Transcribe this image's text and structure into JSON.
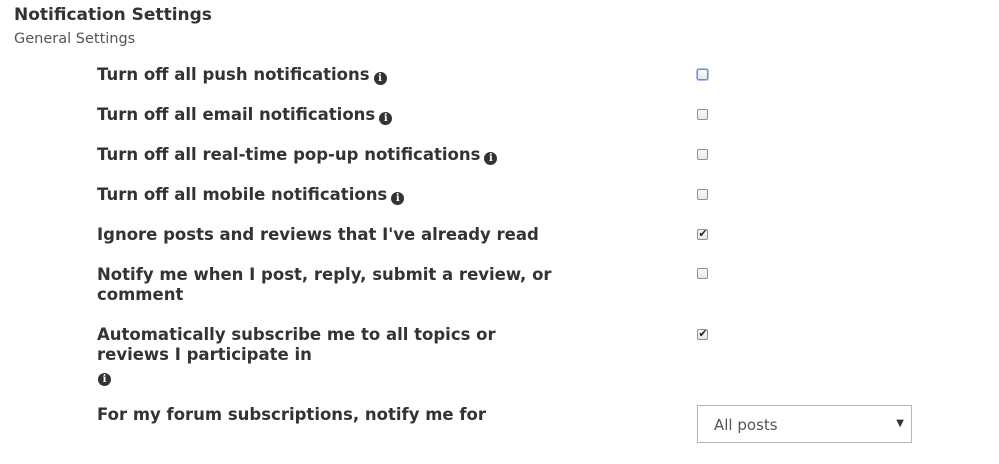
{
  "header": {
    "title": "Notification Settings",
    "subtitle": "General Settings"
  },
  "settings": [
    {
      "label": "Turn off all push notifications",
      "info": true,
      "checked": false,
      "focused": true
    },
    {
      "label": "Turn off all email notifications",
      "info": true,
      "checked": false
    },
    {
      "label": "Turn off all real-time pop-up notifications",
      "info": true,
      "checked": false
    },
    {
      "label": "Turn off all mobile notifications",
      "info": true,
      "checked": false
    },
    {
      "label": "Ignore posts and reviews that I've already read",
      "info": false,
      "checked": true
    },
    {
      "label": "Notify me when I post, reply, submit a review, or comment",
      "info": false,
      "checked": false
    },
    {
      "label": "Automatically subscribe me to all topics or reviews I participate in",
      "info": true,
      "checked": true
    }
  ],
  "forum_subscription": {
    "label": "For my forum subscriptions, notify me for",
    "selected": "All posts"
  },
  "icons": {
    "info": "info-circle-icon",
    "check": "checkmark-icon",
    "caret": "caret-down-icon"
  }
}
